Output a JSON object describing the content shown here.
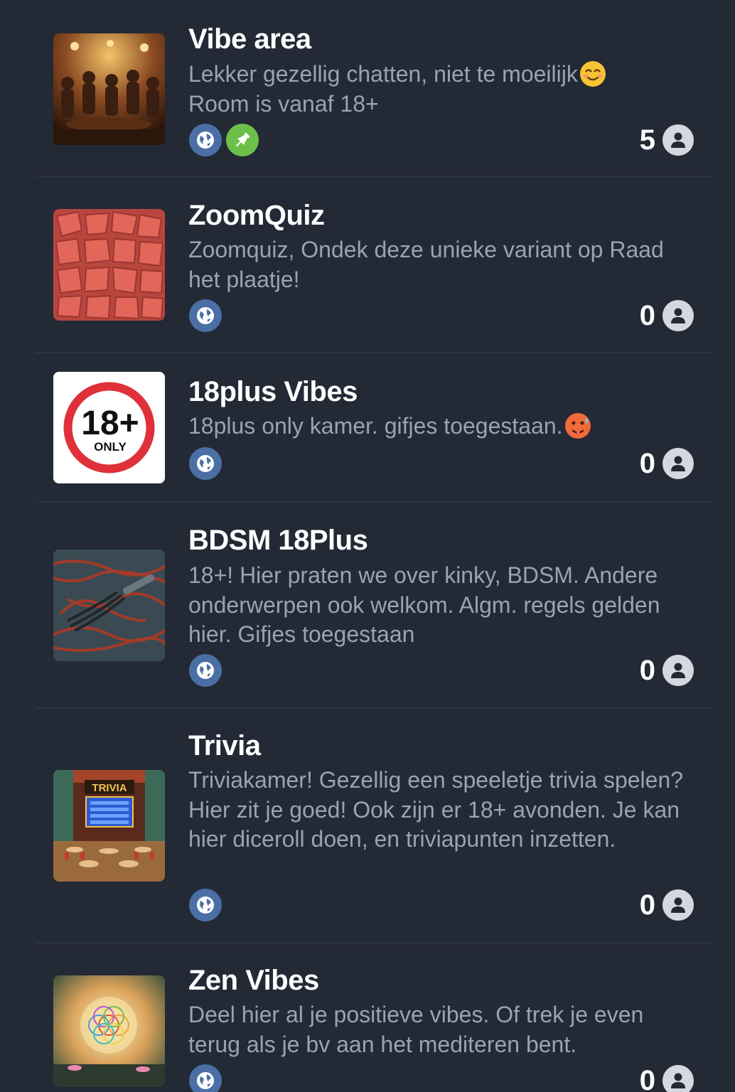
{
  "rooms": [
    {
      "name": "Vibe area",
      "description": "Lekker gezellig chatten, niet te moeilijk",
      "description_emoji": "smiling-face-emoji",
      "description_line2": "Room is vanaf 18+",
      "badges": [
        "globe-icon",
        "pin-icon"
      ],
      "user_count": "5",
      "thumbnail": "bar-crowd-image"
    },
    {
      "name": "ZoomQuiz",
      "description": "Zoomquiz, Ondek deze unieke variant op Raad het plaatje!",
      "badges": [
        "globe-icon"
      ],
      "user_count": "0",
      "thumbnail": "watermelon-image"
    },
    {
      "name": "18plus Vibes",
      "description": "18plus only kamer. gifjes toegestaan.",
      "description_emoji": "hot-face-emoji",
      "badges": [
        "globe-icon"
      ],
      "user_count": "0",
      "thumbnail": "18-plus-only-sign",
      "thumbnail_text": "18+",
      "thumbnail_subtext": "ONLY"
    },
    {
      "name": "BDSM 18Plus",
      "description": "18+! Hier praten we over kinky, BDSM. Andere onderwerpen ook welkom. Algm. regels gelden hier. Gifjes toegestaan",
      "badges": [
        "globe-icon"
      ],
      "user_count": "0",
      "thumbnail": "rope-and-whip-image"
    },
    {
      "name": "Trivia",
      "description": "Triviakamer! Gezellig een speeletje trivia spelen? Hier zit je goed! Ook zijn er 18+ avonden. Je kan hier diceroll doen, en triviapunten inzetten.",
      "badges": [
        "globe-icon"
      ],
      "user_count": "0",
      "thumbnail": "trivia-room-image",
      "thumbnail_text": "TRIVIA"
    },
    {
      "name": "Zen Vibes",
      "description": "Deel hier al je positieve vibes. Of trek je even terug als je bv aan het mediteren bent.",
      "badges": [
        "globe-icon"
      ],
      "user_count": "0",
      "thumbnail": "flower-of-life-image"
    }
  ],
  "colors": {
    "background": "#232935",
    "title": "#ffffff",
    "description": "#9aa3b2",
    "globe_badge": "#4a6fa5",
    "pin_badge": "#6cc04a",
    "divider": "#2d3441"
  }
}
